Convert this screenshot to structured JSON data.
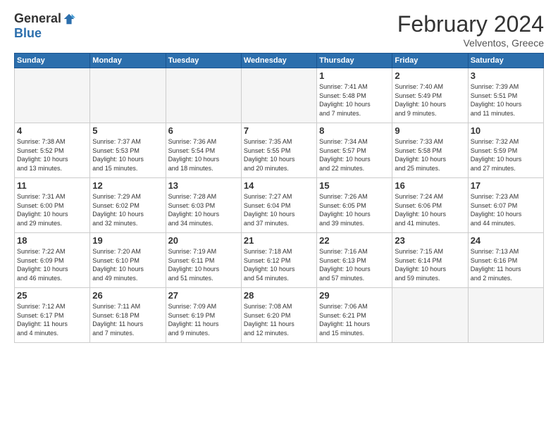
{
  "header": {
    "logo_general": "General",
    "logo_blue": "Blue",
    "title": "February 2024",
    "location": "Velventos, Greece"
  },
  "weekdays": [
    "Sunday",
    "Monday",
    "Tuesday",
    "Wednesday",
    "Thursday",
    "Friday",
    "Saturday"
  ],
  "weeks": [
    [
      {
        "day": "",
        "info": ""
      },
      {
        "day": "",
        "info": ""
      },
      {
        "day": "",
        "info": ""
      },
      {
        "day": "",
        "info": ""
      },
      {
        "day": "1",
        "info": "Sunrise: 7:41 AM\nSunset: 5:48 PM\nDaylight: 10 hours\nand 7 minutes."
      },
      {
        "day": "2",
        "info": "Sunrise: 7:40 AM\nSunset: 5:49 PM\nDaylight: 10 hours\nand 9 minutes."
      },
      {
        "day": "3",
        "info": "Sunrise: 7:39 AM\nSunset: 5:51 PM\nDaylight: 10 hours\nand 11 minutes."
      }
    ],
    [
      {
        "day": "4",
        "info": "Sunrise: 7:38 AM\nSunset: 5:52 PM\nDaylight: 10 hours\nand 13 minutes."
      },
      {
        "day": "5",
        "info": "Sunrise: 7:37 AM\nSunset: 5:53 PM\nDaylight: 10 hours\nand 15 minutes."
      },
      {
        "day": "6",
        "info": "Sunrise: 7:36 AM\nSunset: 5:54 PM\nDaylight: 10 hours\nand 18 minutes."
      },
      {
        "day": "7",
        "info": "Sunrise: 7:35 AM\nSunset: 5:55 PM\nDaylight: 10 hours\nand 20 minutes."
      },
      {
        "day": "8",
        "info": "Sunrise: 7:34 AM\nSunset: 5:57 PM\nDaylight: 10 hours\nand 22 minutes."
      },
      {
        "day": "9",
        "info": "Sunrise: 7:33 AM\nSunset: 5:58 PM\nDaylight: 10 hours\nand 25 minutes."
      },
      {
        "day": "10",
        "info": "Sunrise: 7:32 AM\nSunset: 5:59 PM\nDaylight: 10 hours\nand 27 minutes."
      }
    ],
    [
      {
        "day": "11",
        "info": "Sunrise: 7:31 AM\nSunset: 6:00 PM\nDaylight: 10 hours\nand 29 minutes."
      },
      {
        "day": "12",
        "info": "Sunrise: 7:29 AM\nSunset: 6:02 PM\nDaylight: 10 hours\nand 32 minutes."
      },
      {
        "day": "13",
        "info": "Sunrise: 7:28 AM\nSunset: 6:03 PM\nDaylight: 10 hours\nand 34 minutes."
      },
      {
        "day": "14",
        "info": "Sunrise: 7:27 AM\nSunset: 6:04 PM\nDaylight: 10 hours\nand 37 minutes."
      },
      {
        "day": "15",
        "info": "Sunrise: 7:26 AM\nSunset: 6:05 PM\nDaylight: 10 hours\nand 39 minutes."
      },
      {
        "day": "16",
        "info": "Sunrise: 7:24 AM\nSunset: 6:06 PM\nDaylight: 10 hours\nand 41 minutes."
      },
      {
        "day": "17",
        "info": "Sunrise: 7:23 AM\nSunset: 6:07 PM\nDaylight: 10 hours\nand 44 minutes."
      }
    ],
    [
      {
        "day": "18",
        "info": "Sunrise: 7:22 AM\nSunset: 6:09 PM\nDaylight: 10 hours\nand 46 minutes."
      },
      {
        "day": "19",
        "info": "Sunrise: 7:20 AM\nSunset: 6:10 PM\nDaylight: 10 hours\nand 49 minutes."
      },
      {
        "day": "20",
        "info": "Sunrise: 7:19 AM\nSunset: 6:11 PM\nDaylight: 10 hours\nand 51 minutes."
      },
      {
        "day": "21",
        "info": "Sunrise: 7:18 AM\nSunset: 6:12 PM\nDaylight: 10 hours\nand 54 minutes."
      },
      {
        "day": "22",
        "info": "Sunrise: 7:16 AM\nSunset: 6:13 PM\nDaylight: 10 hours\nand 57 minutes."
      },
      {
        "day": "23",
        "info": "Sunrise: 7:15 AM\nSunset: 6:14 PM\nDaylight: 10 hours\nand 59 minutes."
      },
      {
        "day": "24",
        "info": "Sunrise: 7:13 AM\nSunset: 6:16 PM\nDaylight: 11 hours\nand 2 minutes."
      }
    ],
    [
      {
        "day": "25",
        "info": "Sunrise: 7:12 AM\nSunset: 6:17 PM\nDaylight: 11 hours\nand 4 minutes."
      },
      {
        "day": "26",
        "info": "Sunrise: 7:11 AM\nSunset: 6:18 PM\nDaylight: 11 hours\nand 7 minutes."
      },
      {
        "day": "27",
        "info": "Sunrise: 7:09 AM\nSunset: 6:19 PM\nDaylight: 11 hours\nand 9 minutes."
      },
      {
        "day": "28",
        "info": "Sunrise: 7:08 AM\nSunset: 6:20 PM\nDaylight: 11 hours\nand 12 minutes."
      },
      {
        "day": "29",
        "info": "Sunrise: 7:06 AM\nSunset: 6:21 PM\nDaylight: 11 hours\nand 15 minutes."
      },
      {
        "day": "",
        "info": ""
      },
      {
        "day": "",
        "info": ""
      }
    ]
  ]
}
